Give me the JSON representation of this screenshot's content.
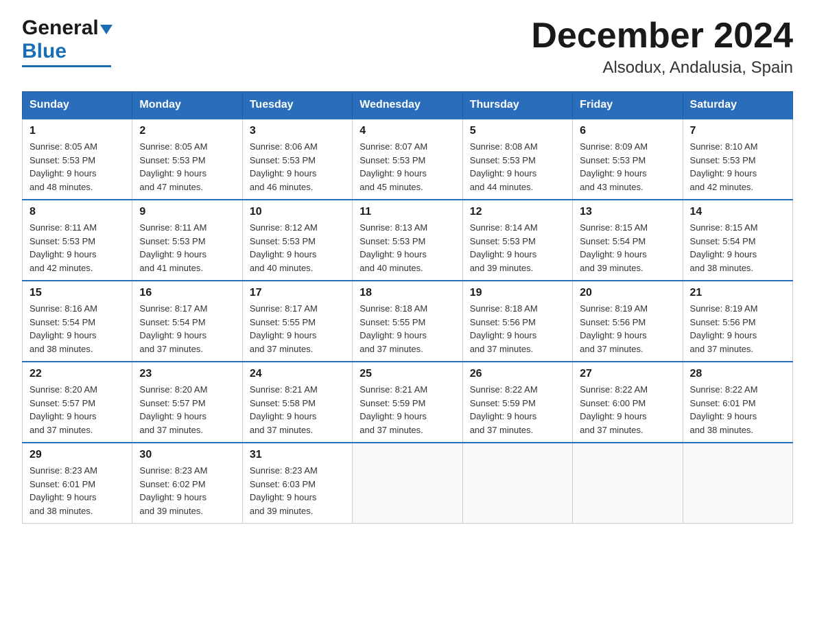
{
  "logo": {
    "general": "General",
    "blue": "Blue"
  },
  "title": "December 2024",
  "subtitle": "Alsodux, Andalusia, Spain",
  "days_of_week": [
    "Sunday",
    "Monday",
    "Tuesday",
    "Wednesday",
    "Thursday",
    "Friday",
    "Saturday"
  ],
  "weeks": [
    [
      {
        "day": "1",
        "sunrise": "8:05 AM",
        "sunset": "5:53 PM",
        "daylight": "9 hours and 48 minutes."
      },
      {
        "day": "2",
        "sunrise": "8:05 AM",
        "sunset": "5:53 PM",
        "daylight": "9 hours and 47 minutes."
      },
      {
        "day": "3",
        "sunrise": "8:06 AM",
        "sunset": "5:53 PM",
        "daylight": "9 hours and 46 minutes."
      },
      {
        "day": "4",
        "sunrise": "8:07 AM",
        "sunset": "5:53 PM",
        "daylight": "9 hours and 45 minutes."
      },
      {
        "day": "5",
        "sunrise": "8:08 AM",
        "sunset": "5:53 PM",
        "daylight": "9 hours and 44 minutes."
      },
      {
        "day": "6",
        "sunrise": "8:09 AM",
        "sunset": "5:53 PM",
        "daylight": "9 hours and 43 minutes."
      },
      {
        "day": "7",
        "sunrise": "8:10 AM",
        "sunset": "5:53 PM",
        "daylight": "9 hours and 42 minutes."
      }
    ],
    [
      {
        "day": "8",
        "sunrise": "8:11 AM",
        "sunset": "5:53 PM",
        "daylight": "9 hours and 42 minutes."
      },
      {
        "day": "9",
        "sunrise": "8:11 AM",
        "sunset": "5:53 PM",
        "daylight": "9 hours and 41 minutes."
      },
      {
        "day": "10",
        "sunrise": "8:12 AM",
        "sunset": "5:53 PM",
        "daylight": "9 hours and 40 minutes."
      },
      {
        "day": "11",
        "sunrise": "8:13 AM",
        "sunset": "5:53 PM",
        "daylight": "9 hours and 40 minutes."
      },
      {
        "day": "12",
        "sunrise": "8:14 AM",
        "sunset": "5:53 PM",
        "daylight": "9 hours and 39 minutes."
      },
      {
        "day": "13",
        "sunrise": "8:15 AM",
        "sunset": "5:54 PM",
        "daylight": "9 hours and 39 minutes."
      },
      {
        "day": "14",
        "sunrise": "8:15 AM",
        "sunset": "5:54 PM",
        "daylight": "9 hours and 38 minutes."
      }
    ],
    [
      {
        "day": "15",
        "sunrise": "8:16 AM",
        "sunset": "5:54 PM",
        "daylight": "9 hours and 38 minutes."
      },
      {
        "day": "16",
        "sunrise": "8:17 AM",
        "sunset": "5:54 PM",
        "daylight": "9 hours and 37 minutes."
      },
      {
        "day": "17",
        "sunrise": "8:17 AM",
        "sunset": "5:55 PM",
        "daylight": "9 hours and 37 minutes."
      },
      {
        "day": "18",
        "sunrise": "8:18 AM",
        "sunset": "5:55 PM",
        "daylight": "9 hours and 37 minutes."
      },
      {
        "day": "19",
        "sunrise": "8:18 AM",
        "sunset": "5:56 PM",
        "daylight": "9 hours and 37 minutes."
      },
      {
        "day": "20",
        "sunrise": "8:19 AM",
        "sunset": "5:56 PM",
        "daylight": "9 hours and 37 minutes."
      },
      {
        "day": "21",
        "sunrise": "8:19 AM",
        "sunset": "5:56 PM",
        "daylight": "9 hours and 37 minutes."
      }
    ],
    [
      {
        "day": "22",
        "sunrise": "8:20 AM",
        "sunset": "5:57 PM",
        "daylight": "9 hours and 37 minutes."
      },
      {
        "day": "23",
        "sunrise": "8:20 AM",
        "sunset": "5:57 PM",
        "daylight": "9 hours and 37 minutes."
      },
      {
        "day": "24",
        "sunrise": "8:21 AM",
        "sunset": "5:58 PM",
        "daylight": "9 hours and 37 minutes."
      },
      {
        "day": "25",
        "sunrise": "8:21 AM",
        "sunset": "5:59 PM",
        "daylight": "9 hours and 37 minutes."
      },
      {
        "day": "26",
        "sunrise": "8:22 AM",
        "sunset": "5:59 PM",
        "daylight": "9 hours and 37 minutes."
      },
      {
        "day": "27",
        "sunrise": "8:22 AM",
        "sunset": "6:00 PM",
        "daylight": "9 hours and 37 minutes."
      },
      {
        "day": "28",
        "sunrise": "8:22 AM",
        "sunset": "6:01 PM",
        "daylight": "9 hours and 38 minutes."
      }
    ],
    [
      {
        "day": "29",
        "sunrise": "8:23 AM",
        "sunset": "6:01 PM",
        "daylight": "9 hours and 38 minutes."
      },
      {
        "day": "30",
        "sunrise": "8:23 AM",
        "sunset": "6:02 PM",
        "daylight": "9 hours and 39 minutes."
      },
      {
        "day": "31",
        "sunrise": "8:23 AM",
        "sunset": "6:03 PM",
        "daylight": "9 hours and 39 minutes."
      },
      null,
      null,
      null,
      null
    ]
  ]
}
